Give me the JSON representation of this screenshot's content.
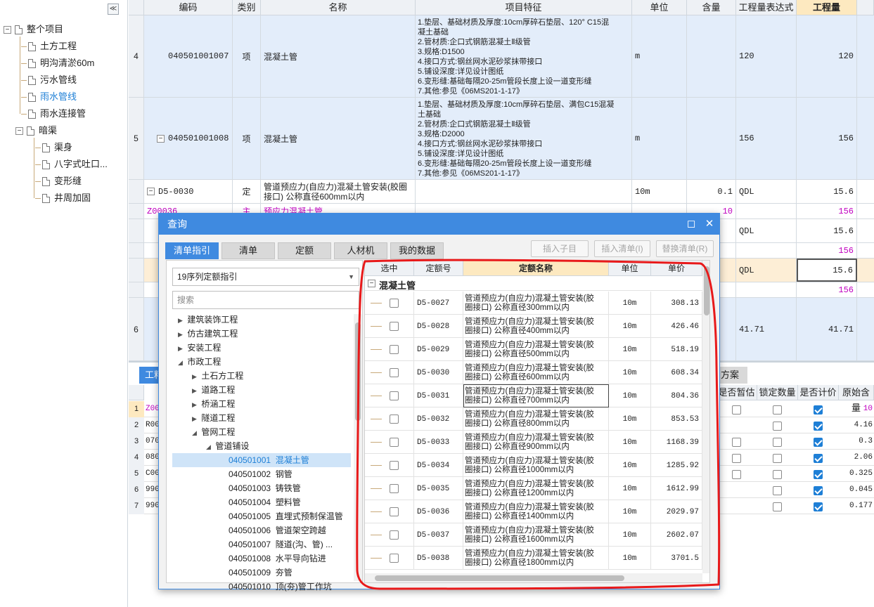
{
  "sidebar": {
    "collapse": "≪",
    "root": "整个项目",
    "items": [
      "土方工程",
      "明沟清淤60m",
      "污水管线",
      "雨水管线",
      "雨水连接管",
      "暗渠"
    ],
    "sub_items": [
      "渠身",
      "八字式吐口...",
      "变形缝",
      "井周加固"
    ]
  },
  "grid": {
    "headers": [
      "编码",
      "类别",
      "名称",
      "项目特征",
      "单位",
      "含量",
      "工程量表达式",
      "工程量"
    ],
    "rows": [
      {
        "num": "4",
        "code": "040501001007",
        "type": "项",
        "name": "混凝土管",
        "feature": "1.垫层、基础材质及厚度:10cm厚碎石垫层、120° C15混\n凝土基础\n2.管材质:企口式钢筋混凝土Ⅱ级管\n3.规格:D1500\n4.接口方式:钢丝网水泥砂浆抹带接口\n5.铺设深度:详见设计图纸\n6.变形缝:基础每隔20-25m管段长度上设一道变形缝\n7.其他:参见《06MS201-1-17》",
        "unit": "m",
        "qty_content": "",
        "expr": "120",
        "qty": "120"
      },
      {
        "num": "5",
        "code": "040501001008",
        "type": "项",
        "name": "混凝土管",
        "feature": "1.垫层、基础材质及厚度:10cm厚碎石垫层、满包C15混凝\n土基础\n2.管材质:企口式钢筋混凝土Ⅱ级管\n3.规格:D2000\n4.接口方式:钢丝网水泥砂浆抹带接口\n5.铺设深度:详见设计图纸\n6.变形缝:基础每隔20-25m管段长度上设一道变形缝\n7.其他:参见《06MS201-1-17》",
        "unit": "m",
        "qty_content": "",
        "expr": "156",
        "qty": "156"
      },
      {
        "num": "",
        "code": "D5-0030",
        "type": "定",
        "name": "管道预应力(自应力)混凝土管安装(胶圈\n接口) 公称直径600mm以内",
        "feature": "",
        "unit": "10m",
        "qty_content": "0.1",
        "expr": "QDL",
        "qty": "15.6"
      },
      {
        "num": "",
        "code": "Z00036",
        "type": "主",
        "name": "预应力混凝土管",
        "feature": "",
        "unit": "",
        "qty_content": "10",
        "expr": "",
        "qty": "156"
      },
      {
        "num": "",
        "code": "",
        "type": "",
        "name": "",
        "feature": "",
        "unit": "",
        "qty_content": "",
        "expr": "QDL",
        "qty": "15.6"
      },
      {
        "num": "",
        "code": "",
        "type": "",
        "name": "",
        "feature": "",
        "unit": "",
        "qty_content": "",
        "expr": "",
        "qty": "156"
      },
      {
        "num": "",
        "code": "",
        "type": "",
        "name": "",
        "feature": "",
        "unit": "",
        "qty_content": "",
        "expr": "QDL",
        "qty": "15.6"
      },
      {
        "num": "",
        "code": "",
        "type": "",
        "name": "",
        "feature": "",
        "unit": "",
        "qty_content": "",
        "expr": "",
        "qty": "156"
      },
      {
        "num": "6",
        "code": "",
        "type": "",
        "name": "",
        "feature": "",
        "unit": "",
        "qty_content": "",
        "expr": "41.71",
        "qty": "41.71"
      }
    ]
  },
  "bottom": {
    "tab_left": "工料",
    "tab_right": "方案",
    "headers": [
      "是否暂估",
      "锁定数量",
      "是否计价",
      "原始含量"
    ],
    "rows": [
      {
        "n": "1",
        "code": "Z00",
        "est": false,
        "lock": false,
        "price": true,
        "orig": "10"
      },
      {
        "n": "2",
        "code": "R00",
        "est": null,
        "lock": false,
        "price": true,
        "orig": "4.16"
      },
      {
        "n": "3",
        "code": "070",
        "est": false,
        "lock": false,
        "price": true,
        "orig": "0.3"
      },
      {
        "n": "4",
        "code": "080",
        "est": false,
        "lock": false,
        "price": true,
        "orig": "2.06"
      },
      {
        "n": "5",
        "code": "C00",
        "est": false,
        "lock": false,
        "price": true,
        "orig": "0.325"
      },
      {
        "n": "6",
        "code": "990",
        "est": null,
        "lock": false,
        "price": true,
        "orig": "0.045"
      },
      {
        "n": "7",
        "code": "990",
        "est": null,
        "lock": false,
        "price": true,
        "orig": "0.177"
      }
    ]
  },
  "dialog": {
    "title": "查询",
    "tabs": [
      "清单指引",
      "清单",
      "定额",
      "人材机",
      "我的数据"
    ],
    "buttons": [
      "插入子目",
      "插入清单(I)",
      "替换清单(R)"
    ],
    "library": "19序列定额指引",
    "search_placeholder": "搜索",
    "tree": [
      {
        "label": "建筑装饰工程",
        "level": 0,
        "open": false
      },
      {
        "label": "仿古建筑工程",
        "level": 0,
        "open": false
      },
      {
        "label": "安装工程",
        "level": 0,
        "open": false
      },
      {
        "label": "市政工程",
        "level": 0,
        "open": true
      },
      {
        "label": "土石方工程",
        "level": 1,
        "open": false
      },
      {
        "label": "道路工程",
        "level": 1,
        "open": false
      },
      {
        "label": "桥涵工程",
        "level": 1,
        "open": false
      },
      {
        "label": "隧道工程",
        "level": 1,
        "open": false
      },
      {
        "label": "管网工程",
        "level": 1,
        "open": true
      },
      {
        "label": "管道铺设",
        "level": 2,
        "open": true
      },
      {
        "label": "040501001  混凝土管",
        "level": 3,
        "sel": true
      },
      {
        "label": "040501002  钢管",
        "level": 3
      },
      {
        "label": "040501003  铸铁管",
        "level": 3
      },
      {
        "label": "040501004  塑料管",
        "level": 3
      },
      {
        "label": "040501005  直埋式预制保温管",
        "level": 3
      },
      {
        "label": "040501006  管道架空跨越",
        "level": 3
      },
      {
        "label": "040501007  隧道(沟、管) ...",
        "level": 3
      },
      {
        "label": "040501008  水平导向钻进",
        "level": 3
      },
      {
        "label": "040501009  夯管",
        "level": 3
      },
      {
        "label": "040501010  顶(夯)管工作坑",
        "level": 3
      }
    ],
    "right_headers": [
      "选中",
      "定额号",
      "定额名称",
      "单位",
      "单价"
    ],
    "group": "混凝土管",
    "quotas": [
      {
        "code": "D5-0027",
        "name": "管道预应力(自应力)混凝土管安装(胶\n圈接口) 公称直径300mm以内",
        "unit": "10m",
        "price": "308.13"
      },
      {
        "code": "D5-0028",
        "name": "管道预应力(自应力)混凝土管安装(胶\n圈接口) 公称直径400mm以内",
        "unit": "10m",
        "price": "426.46"
      },
      {
        "code": "D5-0029",
        "name": "管道预应力(自应力)混凝土管安装(胶\n圈接口) 公称直径500mm以内",
        "unit": "10m",
        "price": "518.19"
      },
      {
        "code": "D5-0030",
        "name": "管道预应力(自应力)混凝土管安装(胶\n圈接口) 公称直径600mm以内",
        "unit": "10m",
        "price": "608.34"
      },
      {
        "code": "D5-0031",
        "name": "管道预应力(自应力)混凝土管安装(胶\n圈接口) 公称直径700mm以内",
        "unit": "10m",
        "price": "804.36"
      },
      {
        "code": "D5-0032",
        "name": "管道预应力(自应力)混凝土管安装(胶\n圈接口) 公称直径800mm以内",
        "unit": "10m",
        "price": "853.53"
      },
      {
        "code": "D5-0033",
        "name": "管道预应力(自应力)混凝土管安装(胶\n圈接口) 公称直径900mm以内",
        "unit": "10m",
        "price": "1168.39"
      },
      {
        "code": "D5-0034",
        "name": "管道预应力(自应力)混凝土管安装(胶\n圈接口) 公称直径1000mm以内",
        "unit": "10m",
        "price": "1285.92"
      },
      {
        "code": "D5-0035",
        "name": "管道预应力(自应力)混凝土管安装(胶\n圈接口) 公称直径1200mm以内",
        "unit": "10m",
        "price": "1612.99"
      },
      {
        "code": "D5-0036",
        "name": "管道预应力(自应力)混凝土管安装(胶\n圈接口) 公称直径1400mm以内",
        "unit": "10m",
        "price": "2029.97"
      },
      {
        "code": "D5-0037",
        "name": "管道预应力(自应力)混凝土管安装(胶\n圈接口) 公称直径1600mm以内",
        "unit": "10m",
        "price": "2602.07"
      },
      {
        "code": "D5-0038",
        "name": "管道预应力(自应力)混凝土管安装(胶\n圈接口) 公称直径1800mm以内",
        "unit": "10m",
        "price": "3701.5"
      }
    ]
  },
  "colors": {
    "accent": "#3f8ae0",
    "row_highlight": "#e3edfa",
    "header_highlight": "#fde9c0",
    "annotation": "#e8191a",
    "main_material": "#c000c0"
  }
}
